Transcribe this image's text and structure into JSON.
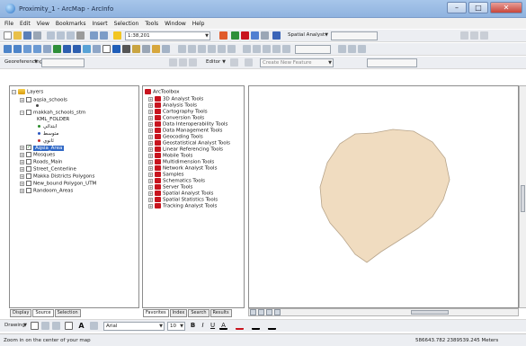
{
  "window": {
    "title": "Proximity_1 - ArcMap - ArcInfo"
  },
  "menu": [
    "File",
    "Edit",
    "View",
    "Bookmarks",
    "Insert",
    "Selection",
    "Tools",
    "Window",
    "Help"
  ],
  "toolbar": {
    "scale": "1:38,201",
    "spatial_analyst": "Spatial Analyst",
    "georeferencing": "Georeferencing",
    "editor": "Editor",
    "create_new_feature": "Create New Feature",
    "drawing": "Drawing",
    "font": "Arial",
    "font_size": "10"
  },
  "toc": {
    "root": "Layers",
    "items": [
      {
        "label": "aqsia_schools",
        "checked": false
      },
      {
        "label": "makkah_schools_stm",
        "checked": false
      },
      {
        "label": "KML_FOLDER",
        "checked": null
      },
      {
        "label": "ابتدائي",
        "checked": null
      },
      {
        "label": "متوسط",
        "checked": null
      },
      {
        "label": "ثانوي",
        "checked": null
      },
      {
        "label": "Aqsia_Area",
        "checked": true
      },
      {
        "label": "Mosques",
        "checked": false
      },
      {
        "label": "Roads_Main",
        "checked": false
      },
      {
        "label": "Street_Centerline",
        "checked": false
      },
      {
        "label": "Makka Districts Polygons",
        "checked": false
      },
      {
        "label": "New_bound Polygon_UTM",
        "checked": false
      },
      {
        "label": "Randoom_Areas",
        "checked": false
      }
    ],
    "tabs": [
      "Display",
      "Source",
      "Selection"
    ]
  },
  "toolbox": {
    "root": "ArcToolbox",
    "items": [
      "3D Analyst Tools",
      "Analysis Tools",
      "Cartography Tools",
      "Conversion Tools",
      "Data Interoperability Tools",
      "Data Management Tools",
      "Geocoding Tools",
      "Geostatistical Analyst Tools",
      "Linear Referencing Tools",
      "Mobile Tools",
      "Multidimension Tools",
      "Network Analyst Tools",
      "Samples",
      "Schematics Tools",
      "Server Tools",
      "Spatial Analyst Tools",
      "Spatial Statistics Tools",
      "Tracking Analyst Tools"
    ],
    "tabs": [
      "Favorites",
      "Index",
      "Search",
      "Results"
    ]
  },
  "status": {
    "message": "Zoom in on the center of your map",
    "coords": "586643.782  2389539.245 Meters"
  },
  "colors": {
    "polygon_fill": "#f0dcc0",
    "polygon_stroke": "#b7a48a",
    "selection": "#3169c6",
    "tool_red": "#c8141e"
  }
}
